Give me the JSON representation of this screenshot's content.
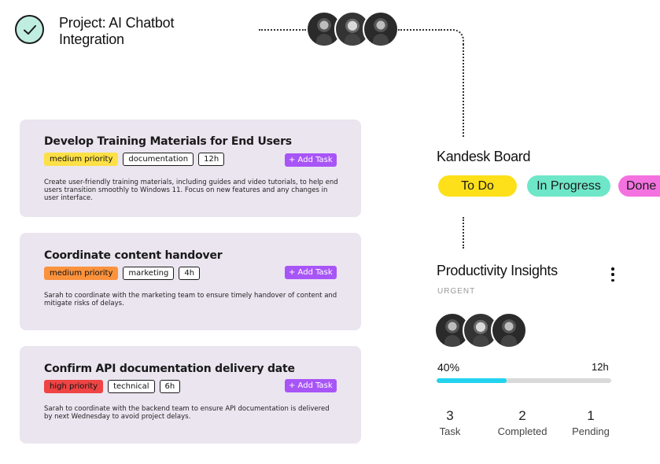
{
  "project": {
    "title": "Project: AI Chatbot Integration"
  },
  "tasks": [
    {
      "title": "Develop Training Materials for End Users",
      "priority": "medium priority",
      "priority_color": "#fde047",
      "category": "documentation",
      "hours": "12h",
      "add_label": "+ Add Task",
      "description": "Create user-friendly training materials, including guides and video tutorials, to help end users transition smoothly to Windows 11. Focus on new features and any changes in user interface."
    },
    {
      "title": "Coordinate content handover",
      "priority": "medium priority",
      "priority_color": "#fb923c",
      "category": "marketing",
      "hours": "4h",
      "add_label": "+ Add Task",
      "description": "Sarah to coordinate with the marketing team to ensure timely handover of content and mitigate risks of delays."
    },
    {
      "title": "Confirm API documentation delivery date",
      "priority": "high priority",
      "priority_color": "#ef4444",
      "category": "technical",
      "hours": "6h",
      "add_label": "+ Add Task",
      "description": "Sarah to coordinate with the backend team to ensure API documentation is delivered by next Wednesday to avoid project delays."
    }
  ],
  "kandesk": {
    "title": "Kandesk Board",
    "statuses": [
      "To Do",
      "In Progress",
      "Done"
    ]
  },
  "insights": {
    "title": "Productivity Insights",
    "tag": "URGENT",
    "progress_label": "40%",
    "progress_value": 0.4,
    "hours": "12h",
    "stats": [
      {
        "value": "3",
        "label": "Task"
      },
      {
        "value": "2",
        "label": "Completed"
      },
      {
        "value": "1",
        "label": "Pending"
      }
    ]
  },
  "colors": {
    "accent": "#a855f7",
    "progress": "#22d3ee",
    "card_bg": "#ebe5f0"
  }
}
